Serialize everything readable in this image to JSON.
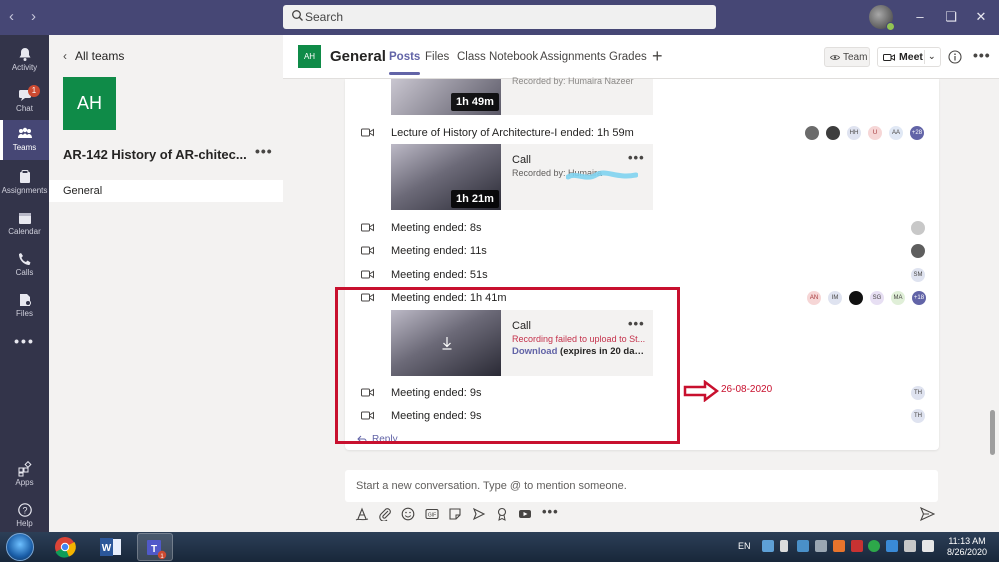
{
  "search": {
    "placeholder": "Search"
  },
  "rail": {
    "items": [
      {
        "label": "Activity",
        "icon": "bell-icon"
      },
      {
        "label": "Chat",
        "icon": "chat-icon",
        "badge": "1"
      },
      {
        "label": "Teams",
        "icon": "teams-icon",
        "active": true
      },
      {
        "label": "Assignments",
        "icon": "assignments-icon"
      },
      {
        "label": "Calendar",
        "icon": "calendar-icon"
      },
      {
        "label": "Calls",
        "icon": "phone-icon"
      },
      {
        "label": "Files",
        "icon": "files-icon"
      },
      {
        "label": "Apps",
        "icon": "apps-icon"
      },
      {
        "label": "Help",
        "icon": "help-icon"
      }
    ]
  },
  "teampanel": {
    "back_label": "All teams",
    "team_initials": "AH",
    "team_name": "AR-142 History of AR-chitec...",
    "channel": "General"
  },
  "header": {
    "channel_initials": "AH",
    "channel_title": "General",
    "tabs": [
      "Posts",
      "Files",
      "Class Notebook",
      "Assignments",
      "Grades"
    ],
    "team_label": "Team",
    "meet_label": "Meet"
  },
  "feed": {
    "partial_recorded_by": "Recorded by: Humaira Nazeer",
    "partial_duration": "1h 49m",
    "lecture_line": "Lecture of History of Architecture-I ended: 1h 59m",
    "lecture_avatars": [
      "HH",
      "U",
      "AA",
      "+28"
    ],
    "card1": {
      "title": "Call",
      "recorded_by": "Recorded by: Humaira",
      "duration": "1h 21m"
    },
    "meetings_top": [
      {
        "text": "Meeting ended: 8s"
      },
      {
        "text": "Meeting ended: 11s"
      },
      {
        "text": "Meeting ended: 51s",
        "avatar": "SM"
      },
      {
        "text": "Meeting ended: 1h 41m"
      }
    ],
    "meeting4_avatars": [
      "AN",
      "IM",
      "SG",
      "MA",
      "+18"
    ],
    "card2": {
      "title": "Call",
      "error": "Recording failed to upload to St...",
      "download": "Download",
      "expires": "(expires in 20 day(..."
    },
    "meetings_bottom": [
      {
        "text": "Meeting ended: 9s",
        "avatar": "TH"
      },
      {
        "text": "Meeting ended: 9s",
        "avatar": "TH"
      }
    ],
    "reply_label": "Reply",
    "annotation_date": "26-08-2020"
  },
  "compose": {
    "placeholder": "Start a new conversation. Type @ to mention someone."
  },
  "taskbar": {
    "lang": "EN",
    "time": "11:13 AM",
    "date": "8/26/2020"
  },
  "colors": {
    "brand": "#464775",
    "accent": "#6264a7",
    "team_tile": "#0f8b48",
    "annotation": "#c8102e"
  }
}
